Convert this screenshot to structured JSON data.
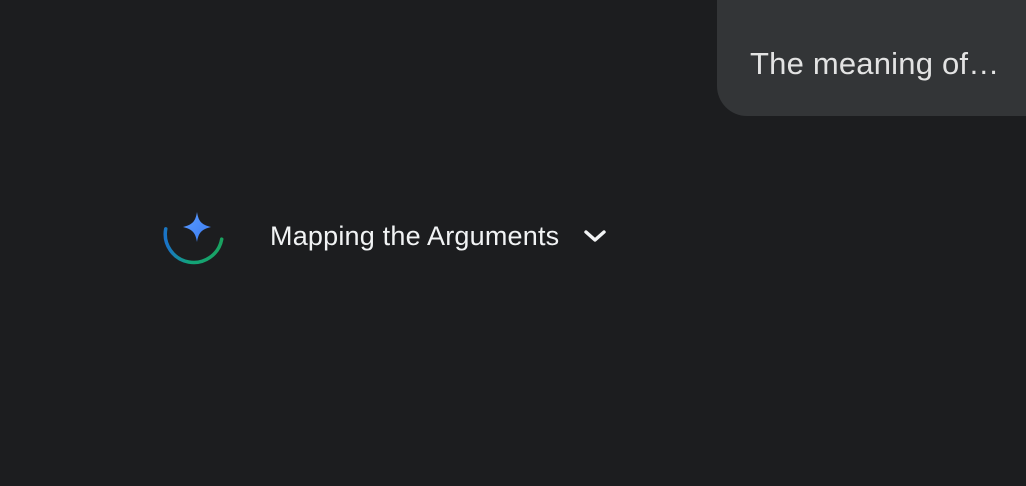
{
  "user_message": {
    "text": "The meaning of…"
  },
  "response": {
    "thinking_title": "Mapping the Arguments",
    "avatar_icon": "gemini-spark-icon",
    "expand_icon": "chevron-down-icon"
  },
  "colors": {
    "background": "#1c1d1f",
    "bubble": "#333537",
    "spark_blue": "#4c8df6",
    "arc_green": "#1aa260",
    "arc_teal": "#1a73c8"
  }
}
